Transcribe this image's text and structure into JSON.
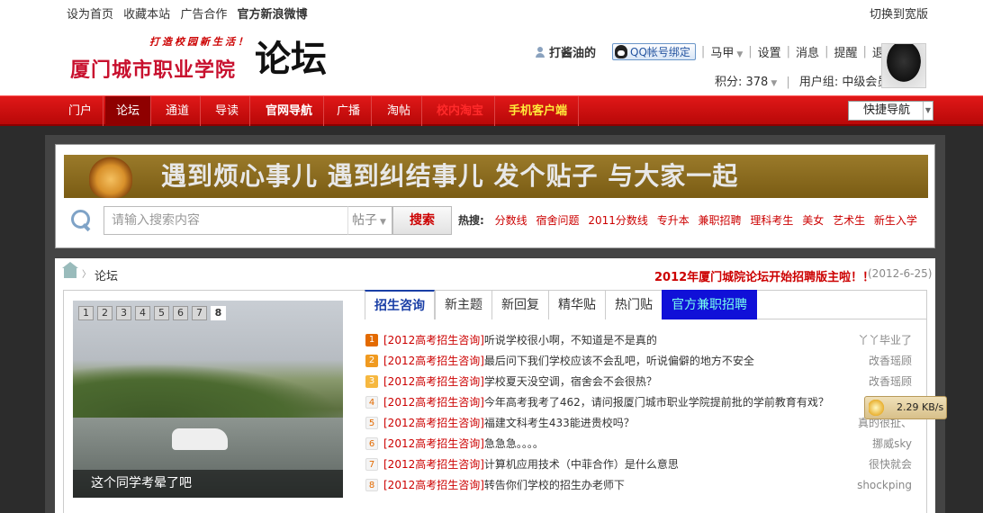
{
  "topbar": {
    "links": [
      "设为首页",
      "收藏本站",
      "广告合作"
    ],
    "weibo": "官方新浪微博",
    "wide": "切换到宽版"
  },
  "logo": {
    "slogan": "打造校园新生活！",
    "name": "厦门城市职业学院",
    "suffix": "论坛"
  },
  "user": {
    "name": "打酱油的",
    "qq_bind": "QQ帐号绑定",
    "status": "马甲",
    "settings": "设置",
    "messages": "消息",
    "reminders": "提醒",
    "logout": "退出",
    "points_label": "积分: 378",
    "group_label": "用户组: 中级会员"
  },
  "nav": {
    "items": [
      "门户",
      "论坛",
      "通道",
      "导读",
      "官网导航",
      "广播",
      "淘帖",
      "校内淘宝",
      "手机客户端"
    ],
    "quick": "快捷导航"
  },
  "banner": {
    "slogan": "遇到烦心事儿 遇到纠结事儿 发个贴子 与大家一起"
  },
  "search": {
    "placeholder": "请输入搜索内容",
    "type": "帖子",
    "button": "搜索",
    "hot_label": "热搜:",
    "hot_words": [
      "分数线",
      "宿舍问题",
      "2011分数线",
      "专升本",
      "兼职招聘",
      "理科考生",
      "美女",
      "艺术生",
      "新生入学"
    ]
  },
  "breadcrumb": {
    "current": "论坛",
    "notice": "2012年厦门城院论坛开始招聘版主啦！！",
    "date": "(2012-6-25)"
  },
  "slider": {
    "pages": [
      "1",
      "2",
      "3",
      "4",
      "5",
      "6",
      "7",
      "8"
    ],
    "active_page": 8,
    "caption": "这个同学考晕了吧"
  },
  "tabs": [
    "招生咨询",
    "新主题",
    "新回复",
    "精华贴",
    "热门贴",
    "官方兼职招聘"
  ],
  "threads": [
    {
      "n": "1",
      "tag": "[2012高考招生咨询]",
      "title": "听说学校很小啊，不知道是不是真的",
      "author": "丫丫毕业了"
    },
    {
      "n": "2",
      "tag": "[2012高考招生咨询]",
      "title": "最后问下我们学校应该不会乱吧，听说偏僻的地方不安全",
      "author": "改香瑶顾"
    },
    {
      "n": "3",
      "tag": "[2012高考招生咨询]",
      "title": "学校夏天没空调，宿舍会不会很热？",
      "author": "改香瑶顾"
    },
    {
      "n": "4",
      "tag": "[2012高考招生咨询]",
      "title": "今年高考我考了462，请问报厦门城市职业学院提前批的学前教育有戏？",
      "author": ""
    },
    {
      "n": "5",
      "tag": "[2012高考招生咨询]",
      "title": "福建文科考生433能进贵校吗？",
      "author": "真的很扯、"
    },
    {
      "n": "6",
      "tag": "[2012高考招生咨询]",
      "title": "急急急。。。。",
      "author": "挪威sky"
    },
    {
      "n": "7",
      "tag": "[2012高考招生咨询]",
      "title": "计算机应用技术（中菲合作）是什么意思",
      "author": "很快就会"
    },
    {
      "n": "8",
      "tag": "[2012高考招生咨询]",
      "title": "转告你们学校的招生办老师下",
      "author": "shockping"
    }
  ],
  "speed": {
    "value": "2.29 KB/s"
  }
}
